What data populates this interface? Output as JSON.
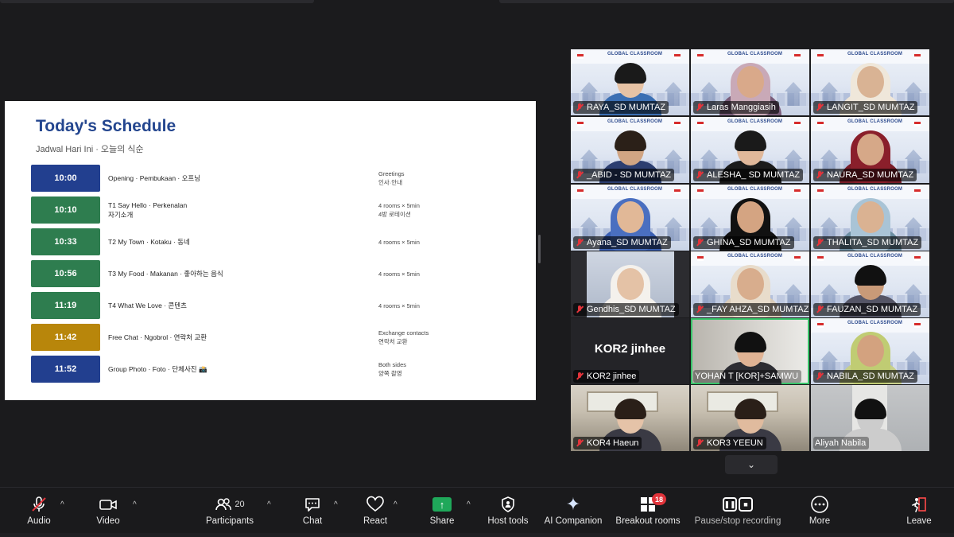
{
  "slide": {
    "title": "Today's Schedule",
    "subtitle": "Jadwal Hari Ini · 오늘의 식순",
    "rows": [
      {
        "time": "10:00",
        "color": "#223f8f",
        "line1": "Opening · Pembukaan · 오프닝",
        "line2": "",
        "note1": "Greetings",
        "note2": "인사·안내"
      },
      {
        "time": "10:10",
        "color": "#2e7d4f",
        "line1": "T1 Say Hello · Perkenalan",
        "line2": "자기소개",
        "note1": "4 rooms × 5min",
        "note2": "4방 로테이션"
      },
      {
        "time": "10:33",
        "color": "#2e7d4f",
        "line1": "T2 My Town · Kotaku · 동네",
        "line2": "",
        "note1": "4 rooms × 5min",
        "note2": ""
      },
      {
        "time": "10:56",
        "color": "#2e7d4f",
        "line1": "T3 My Food · Makanan · 좋아하는 음식",
        "line2": "",
        "note1": "4 rooms × 5min",
        "note2": ""
      },
      {
        "time": "11:19",
        "color": "#2e7d4f",
        "line1": "T4 What We Love · 콘텐츠",
        "line2": "",
        "note1": "4 rooms × 5min",
        "note2": ""
      },
      {
        "time": "11:42",
        "color": "#b8860b",
        "line1": "Free Chat · Ngobrol · 연락처 교환",
        "line2": "",
        "note1": "Exchange contacts",
        "note2": "연락처 교환"
      },
      {
        "time": "11:52",
        "color": "#223f8f",
        "line1": "Group Photo · Foto · 단체사진 📸",
        "line2": "",
        "note1": "Both sides",
        "note2": "양쪽 촬영"
      }
    ]
  },
  "gallery": {
    "banner_text": "GLOBAL CLASSROOM",
    "participants": [
      {
        "name": "RAYA_SD MUMTAZ",
        "muted": true
      },
      {
        "name": "Laras Manggiasih",
        "muted": true
      },
      {
        "name": "LANGIT_SD MUMTAZ",
        "muted": true
      },
      {
        "name": "_ABID - SD MUMTAZ",
        "muted": true
      },
      {
        "name": "ALESHA_ SD MUMTAZ",
        "muted": true
      },
      {
        "name": "NAURA_SD MUMTAZ",
        "muted": true
      },
      {
        "name": "Ayana_SD MUMTAZ",
        "muted": true
      },
      {
        "name": "GHINA_SD MUMTAZ",
        "muted": true
      },
      {
        "name": "THALITA_SD MUMTAZ",
        "muted": true
      },
      {
        "name": "Gendhis_SD MUMTAZ",
        "muted": true
      },
      {
        "name": "_FAY AHZA_SD MUMTAZ",
        "muted": true
      },
      {
        "name": "FAUZAN_SD MUMTAZ",
        "muted": true
      },
      {
        "name": "KOR2 jinhee",
        "muted": true,
        "bigname": "KOR2 jinhee"
      },
      {
        "name": "YOHAN T [KOR]+SAMWU",
        "muted": false
      },
      {
        "name": "NABILA_SD MUMTAZ",
        "muted": true
      },
      {
        "name": "KOR4 Haeun",
        "muted": true
      },
      {
        "name": "KOR3 YEEUN",
        "muted": true
      },
      {
        "name": "Aliyah Nabila",
        "muted": false
      }
    ]
  },
  "toolbar": {
    "audio": "Audio",
    "video": "Video",
    "participants": "Participants",
    "participants_count": "20",
    "chat": "Chat",
    "react": "React",
    "share": "Share",
    "host_tools": "Host tools",
    "ai_companion": "AI Companion",
    "breakout": "Breakout rooms",
    "breakout_badge": "18",
    "recording": "Pause/stop recording",
    "more": "More",
    "leave": "Leave"
  }
}
